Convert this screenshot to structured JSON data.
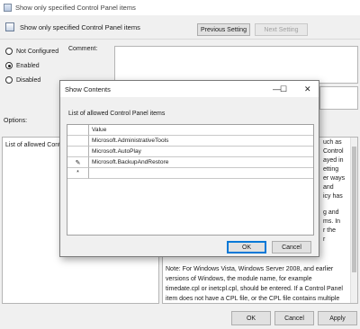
{
  "window": {
    "title": "Show only specified Control Panel items"
  },
  "header": {
    "policy_title": "Show only specified Control Panel items",
    "previous_label": "Previous Setting",
    "next_label": "Next Setting"
  },
  "state": {
    "options": [
      "Not Configured",
      "Enabled",
      "Disabled"
    ],
    "selected": "Enabled"
  },
  "labels": {
    "comment": "Comment:",
    "options": "Options:"
  },
  "options_panel": {
    "list_label": "List of allowed Control Panel items"
  },
  "help": {
    "right_fragments": [
      "uch as",
      "Control",
      "ayed in",
      "etting",
      "er ways",
      "and",
      "icy has",
      "g and",
      "ms. In",
      "r the",
      "r"
    ],
    "note": "Note: For Windows Vista, Windows Server 2008, and earlier versions of Windows, the module name, for example timedate.cpl or inetcpl.cpl, should be entered. If a Control Panel item does not have a CPL file, or the CPL file contains multiple"
  },
  "footer": {
    "ok": "OK",
    "cancel": "Cancel",
    "apply": "Apply"
  },
  "dialog": {
    "title": "Show Contents",
    "list_label": "List of allowed Control Panel items",
    "column_header": "Value",
    "rows": [
      {
        "marker": "",
        "value": "Microsoft.AdministrativeTools"
      },
      {
        "marker": "",
        "value": "Microsoft.AutoPlay"
      },
      {
        "marker": "✎",
        "value": "Microsoft.BackupAndRestore"
      },
      {
        "marker": "*",
        "value": ""
      }
    ],
    "ok": "OK",
    "cancel": "Cancel",
    "controls": {
      "minimize": "—",
      "maximize": "☐",
      "close": "✕"
    }
  }
}
